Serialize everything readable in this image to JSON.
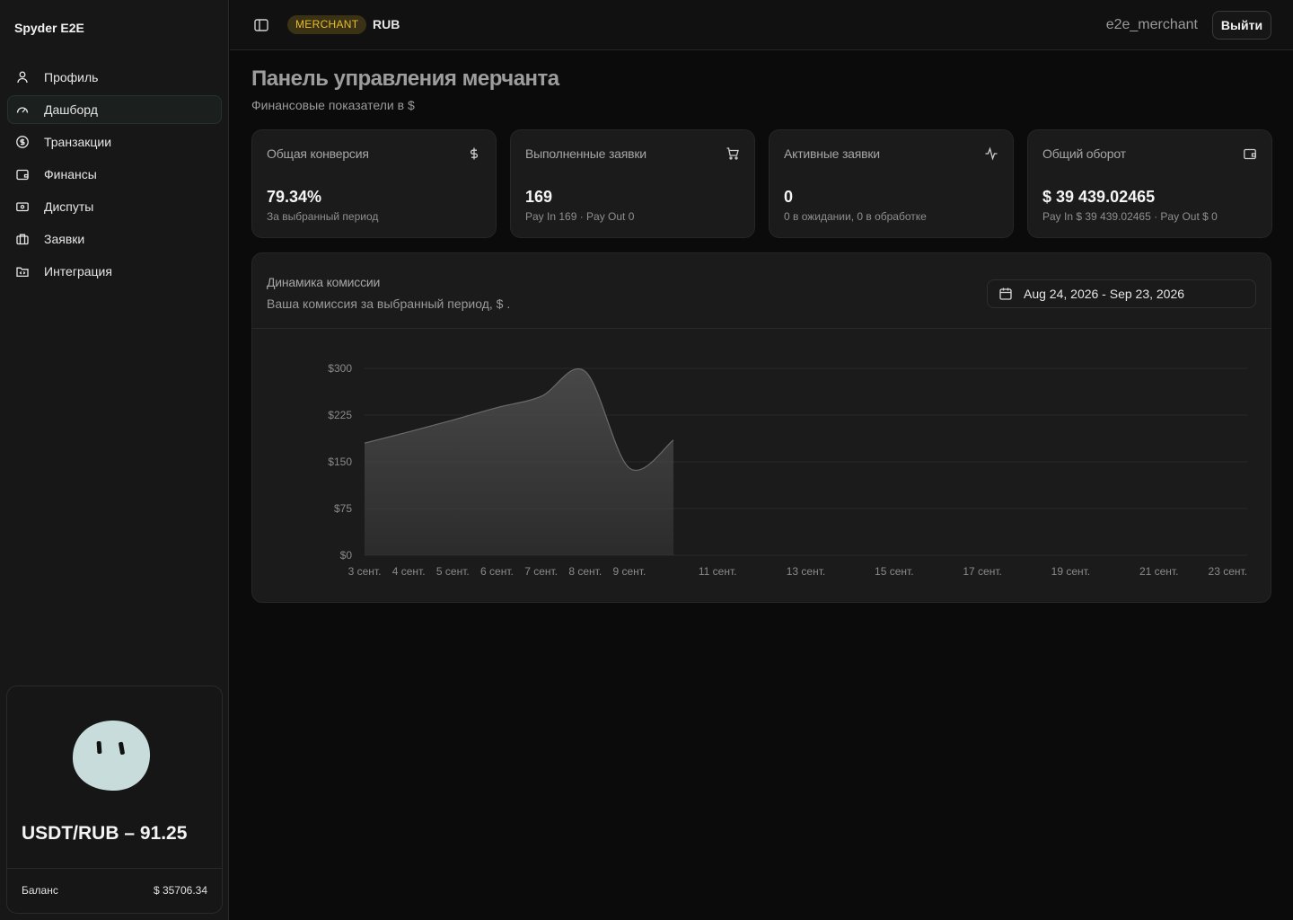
{
  "sidebar": {
    "brand": "Spyder E2E",
    "items": [
      {
        "label": "Профиль",
        "icon": "user-icon"
      },
      {
        "label": "Дашборд",
        "icon": "gauge-icon",
        "active": true
      },
      {
        "label": "Транзакции",
        "icon": "dollar-circle-icon"
      },
      {
        "label": "Финансы",
        "icon": "wallet-icon"
      },
      {
        "label": "Диспуты",
        "icon": "ticket-icon"
      },
      {
        "label": "Заявки",
        "icon": "briefcase-icon"
      },
      {
        "label": "Интеграция",
        "icon": "folder-code-icon"
      }
    ],
    "rate": "USDT/RUB – 91.25",
    "balance_label": "Баланс",
    "balance_value": "$ 35706.34"
  },
  "header": {
    "role_badge": "MERCHANT",
    "currency": "RUB",
    "username": "e2e_merchant",
    "logout_label": "Выйти"
  },
  "main": {
    "title": "Панель управления мерчанта",
    "subtitle": "Финансовые показатели в $",
    "stats": [
      {
        "title": "Общая конверсия",
        "icon": "dollar-icon",
        "value": "79.34%",
        "sub": "За выбранный период"
      },
      {
        "title": "Выполненные заявки",
        "icon": "cart-icon",
        "value": "169",
        "sub": "Pay In 169 · Pay Out 0"
      },
      {
        "title": "Активные заявки",
        "icon": "activity-icon",
        "value": "0",
        "sub": "0 в ожидании, 0 в обработке"
      },
      {
        "title": "Общий оборот",
        "icon": "wallet-icon",
        "value": "$ 39 439.02465",
        "sub": "Pay In $ 39 439.02465 · Pay Out $ 0"
      }
    ],
    "chart_card": {
      "title": "Динамика комиссии",
      "subtitle": "Ваша комиссия за выбранный период, $ .",
      "date_range": "Aug 24, 2026 - Sep 23, 2026"
    }
  },
  "colors": {
    "badge_bg": "#3a3215",
    "badge_text": "#e9bd2b",
    "area_fill": "#4a4a4a",
    "area_stroke": "#6a6a6a"
  },
  "chart_data": {
    "type": "area",
    "x": [
      "3 сент.",
      "4 сент.",
      "5 сент.",
      "6 сент.",
      "7 сент.",
      "8 сент.",
      "9 сент.",
      "10 сент."
    ],
    "values": [
      180,
      198,
      217,
      237,
      255,
      295,
      140,
      185
    ],
    "x_tick_labels": [
      "3 сент.",
      "4 сент.",
      "5 сент.",
      "6 сент.",
      "7 сент.",
      "8 сент.",
      "9 сент.",
      "11 сент.",
      "13 сент.",
      "15 сент.",
      "17 сент.",
      "19 сент.",
      "21 сент.",
      "23 сент."
    ],
    "y_ticks": [
      "$0",
      "$75",
      "$150",
      "$225",
      "$300"
    ],
    "ylim": [
      0,
      300
    ],
    "x_domain_days": [
      3,
      23
    ],
    "grid": true,
    "title": "",
    "xlabel": "",
    "ylabel": ""
  }
}
